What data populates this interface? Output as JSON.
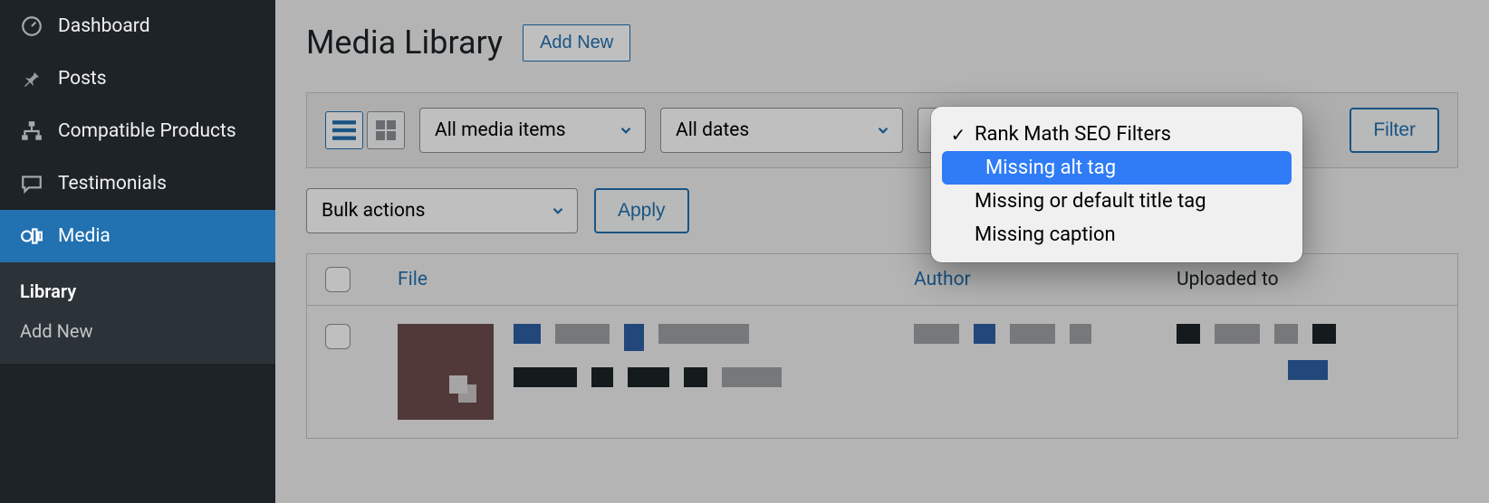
{
  "sidebar": {
    "items": [
      {
        "label": "Dashboard"
      },
      {
        "label": "Posts"
      },
      {
        "label": "Compatible Products"
      },
      {
        "label": "Testimonials"
      },
      {
        "label": "Media"
      }
    ],
    "sub": {
      "library": "Library",
      "add_new": "Add New"
    }
  },
  "header": {
    "title": "Media Library",
    "add_new": "Add New"
  },
  "filter_bar": {
    "media_type": "All media items",
    "dates": "All dates",
    "seo_filter_selected": "Rank Math SEO Filters",
    "filter_btn": "Filter"
  },
  "dropdown": {
    "options": [
      {
        "label": "Rank Math SEO Filters",
        "selected": true
      },
      {
        "label": "Missing alt tag",
        "highlighted": true
      },
      {
        "label": "Missing or default title tag"
      },
      {
        "label": "Missing caption"
      }
    ]
  },
  "bulk": {
    "select": "Bulk actions",
    "apply": "Apply"
  },
  "table": {
    "cols": {
      "file": "File",
      "author": "Author",
      "uploaded_to": "Uploaded to"
    }
  }
}
